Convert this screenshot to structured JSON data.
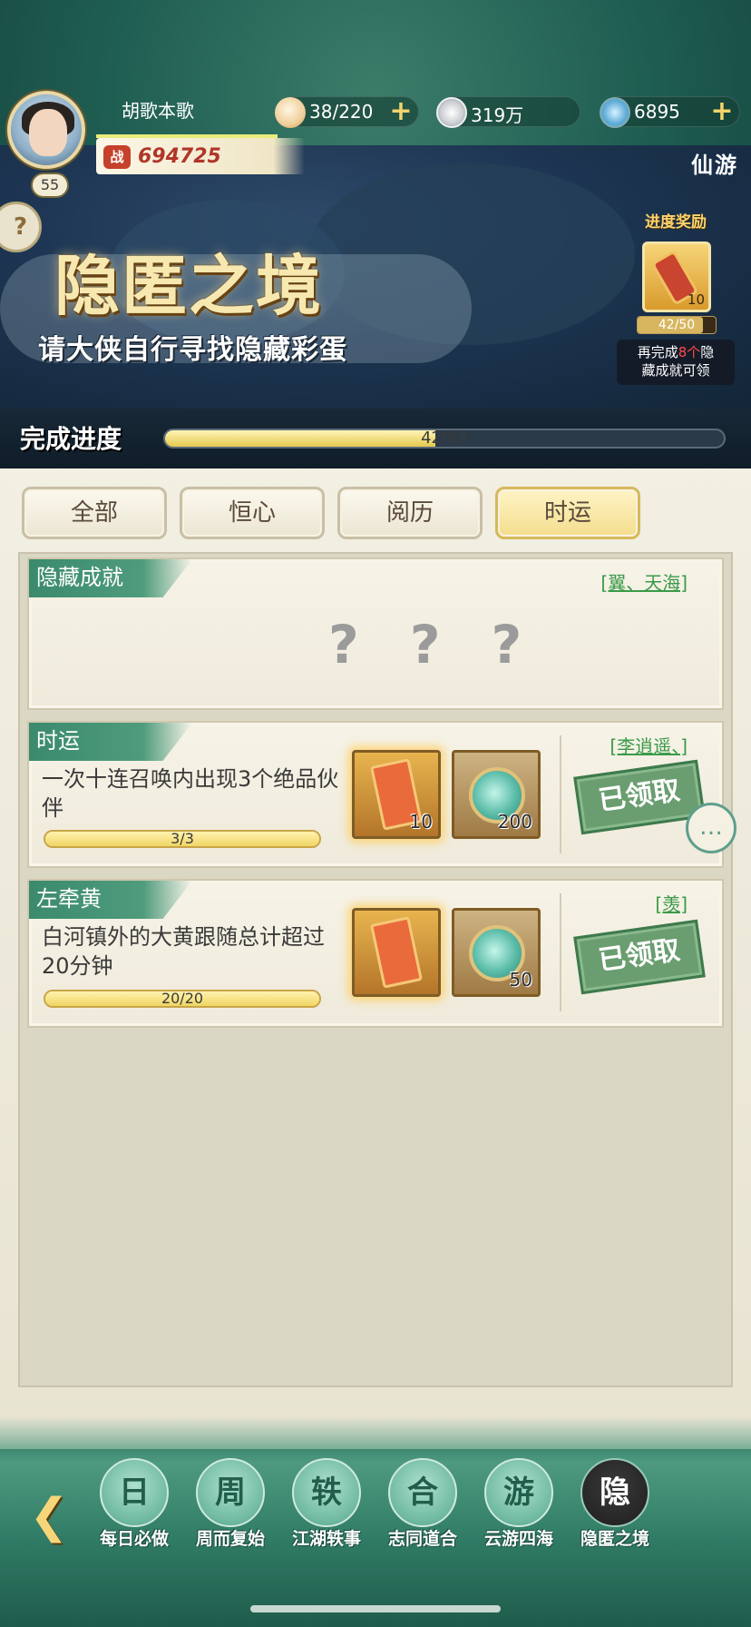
{
  "player": {
    "name": "胡歌本歌",
    "level": "55",
    "power_icon": "战",
    "power": "694725"
  },
  "resources": [
    {
      "icon": "bun-icon",
      "value": "38/220",
      "has_plus": true
    },
    {
      "icon": "coin-icon",
      "value": "319万",
      "has_plus": false
    },
    {
      "icon": "jade-icon",
      "value": "6895",
      "has_plus": true
    }
  ],
  "mode_label": "仙游",
  "banner": {
    "title": "隐匿之境",
    "subtitle": "请大侠自行寻找隐藏彩蛋",
    "side_icon": "?"
  },
  "progress_reward": {
    "label": "进度奖励",
    "count": "10",
    "progress_text": "42/50",
    "progress_fraction": 0.84,
    "hint_prefix": "再完成",
    "hint_highlight": "8个",
    "hint_suffix": "隐",
    "hint_line2": "藏成就可领"
  },
  "completion": {
    "label": "完成进度",
    "text": "42/87",
    "fraction": 0.483
  },
  "tabs": [
    {
      "label": "全部",
      "active": false
    },
    {
      "label": "恒心",
      "active": false
    },
    {
      "label": "阅历",
      "active": false
    },
    {
      "label": "时运",
      "active": true
    }
  ],
  "cards": [
    {
      "tag": "隐藏成就",
      "partner": "[翼、天海]",
      "hidden": "? ? ?"
    },
    {
      "tag": "时运",
      "partner": "[李逍遥、]",
      "desc": "一次十连召唤内出现3个绝品伙伴",
      "progress_text": "3/3",
      "progress_fraction": 1.0,
      "rewards": [
        {
          "icon": "summon-scroll-icon",
          "count": "10"
        },
        {
          "icon": "jade-token-icon",
          "count": "200"
        }
      ],
      "status": "已领取"
    },
    {
      "tag": "左牵黄",
      "partner": "[羡]",
      "desc": "白河镇外的大黄跟随总计超过20分钟",
      "progress_text": "20/20",
      "progress_fraction": 1.0,
      "rewards": [
        {
          "icon": "summon-scroll-icon",
          "count": ""
        },
        {
          "icon": "jade-token-icon",
          "count": "50"
        }
      ],
      "status": "已领取"
    }
  ],
  "bottom_nav": [
    {
      "label": "每日必做",
      "icon": "daily-icon",
      "glyph": "日",
      "active": false
    },
    {
      "label": "周而复始",
      "icon": "weekly-icon",
      "glyph": "周",
      "active": false
    },
    {
      "label": "江湖轶事",
      "icon": "anecdote-icon",
      "glyph": "轶",
      "active": false
    },
    {
      "label": "志同道合",
      "icon": "companion-icon",
      "glyph": "合",
      "active": false
    },
    {
      "label": "云游四海",
      "icon": "travel-icon",
      "glyph": "游",
      "active": false
    },
    {
      "label": "隐匿之境",
      "icon": "hidden-realm-icon",
      "glyph": "隐",
      "active": true
    }
  ],
  "colors": {
    "accent_green": "#3b8a6d",
    "gold": "#f3d36a",
    "partner_link": "#3a9a48",
    "highlight_red": "#ff4a4a"
  }
}
